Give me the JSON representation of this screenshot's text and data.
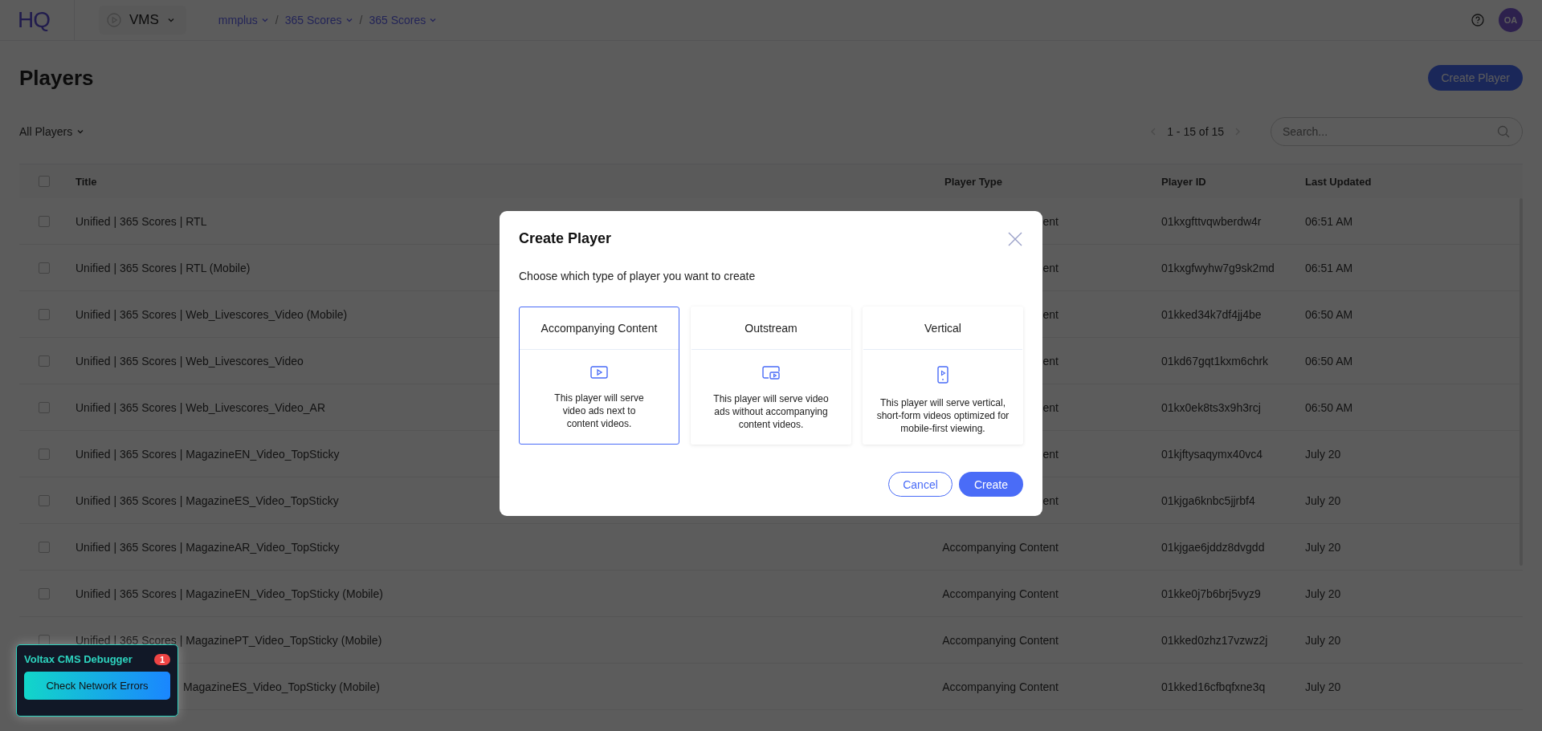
{
  "top_bar": {
    "logo": "HQ",
    "app_switcher": "VMS",
    "breadcrumbs": [
      {
        "label": "mmplus"
      },
      {
        "label": "365 Scores"
      },
      {
        "label": "365 Scores"
      }
    ],
    "breadcrumb_separator": "/",
    "avatar": "OA"
  },
  "page": {
    "title": "Players",
    "create_button": "Create Player",
    "filter": "All Players",
    "pagination": "1 - 15 of 15",
    "search": {
      "placeholder": "Search..."
    }
  },
  "table": {
    "columns": [
      "Title",
      "Player Type",
      "Player ID",
      "Last Updated"
    ],
    "header_checked": false,
    "rows": [
      {
        "checked": false,
        "title": "Unified | 365 Scores | RTL",
        "player_type": "ent",
        "player_id": "01kxgfttvqwberdw4r",
        "last_updated": "06:51 AM"
      },
      {
        "checked": false,
        "title": "Unified | 365 Scores | RTL (Mobile)",
        "player_type": "ent",
        "player_id": "01kxgfwyhw7g9sk2md",
        "last_updated": "06:51 AM"
      },
      {
        "checked": false,
        "title": "Unified | 365 Scores | Web_Livescores_Video (Mobile)",
        "player_type": "ent",
        "player_id": "01kked34k7df4jj4be",
        "last_updated": "06:50 AM"
      },
      {
        "checked": false,
        "title": "Unified | 365 Scores | Web_Livescores_Video",
        "player_type": "ent",
        "player_id": "01kd67gqt1kxm6chrk",
        "last_updated": "06:50 AM"
      },
      {
        "checked": false,
        "title": "Unified | 365 Scores | Web_Livescores_Video_AR",
        "player_type": "ent",
        "player_id": "01kx0ek8ts3x9h3rcj",
        "last_updated": "06:50 AM"
      },
      {
        "checked": false,
        "title": "Unified | 365 Scores | MagazineEN_Video_TopSticky",
        "player_type": "ent",
        "player_id": "01kjftysaqymx40vc4",
        "last_updated": "July 20"
      },
      {
        "checked": false,
        "title": "Unified | 365 Scores | MagazineES_Video_TopSticky",
        "player_type": "ent",
        "player_id": "01kjga6knbc5jjrbf4",
        "last_updated": "July 20"
      },
      {
        "checked": false,
        "title": "Unified | 365 Scores | MagazineAR_Video_TopSticky",
        "player_type": "Accompanying Content",
        "player_id": "01kjgae6jddz8dvgdd",
        "last_updated": "July 20"
      },
      {
        "checked": false,
        "title": "Unified | 365 Scores | MagazineEN_Video_TopSticky (Mobile)",
        "player_type": "Accompanying Content",
        "player_id": "01kke0j7b6brj5vyz9",
        "last_updated": "July 20"
      },
      {
        "checked": false,
        "title": "Unified | 365 Scores | MagazinePT_Video_TopSticky (Mobile)",
        "player_type": "Accompanying Content",
        "player_id": "01kked0zhz17vzwz2j",
        "last_updated": "July 20"
      },
      {
        "title": "MagazineES_Video_TopSticky (Mobile)",
        "player_type": "Accompanying Content",
        "player_id": "01kked16cfbqfxne3q",
        "last_updated": "July 20"
      }
    ]
  },
  "modal": {
    "title": "Create Player",
    "subtitle": "Choose which type of player you want to create",
    "options": [
      {
        "kind": "accompanying",
        "title": "Accompanying Content",
        "description": "This player will serve video ads next to content videos.",
        "selected": true
      },
      {
        "kind": "outstream",
        "title": "Outstream",
        "description": "This player will serve video ads without accompanying content videos.",
        "selected": false
      },
      {
        "kind": "vertical",
        "title": "Vertical",
        "description": "This player will serve vertical, short-form videos optimized for mobile-first viewing.",
        "selected": false
      }
    ],
    "buttons": [
      {
        "kind": "secondary",
        "label": "Cancel"
      },
      {
        "kind": "primary",
        "label": "Create"
      }
    ]
  },
  "debugger": {
    "title": "Voltax CMS Debugger",
    "count": "1",
    "button": "Check Network Errors"
  }
}
